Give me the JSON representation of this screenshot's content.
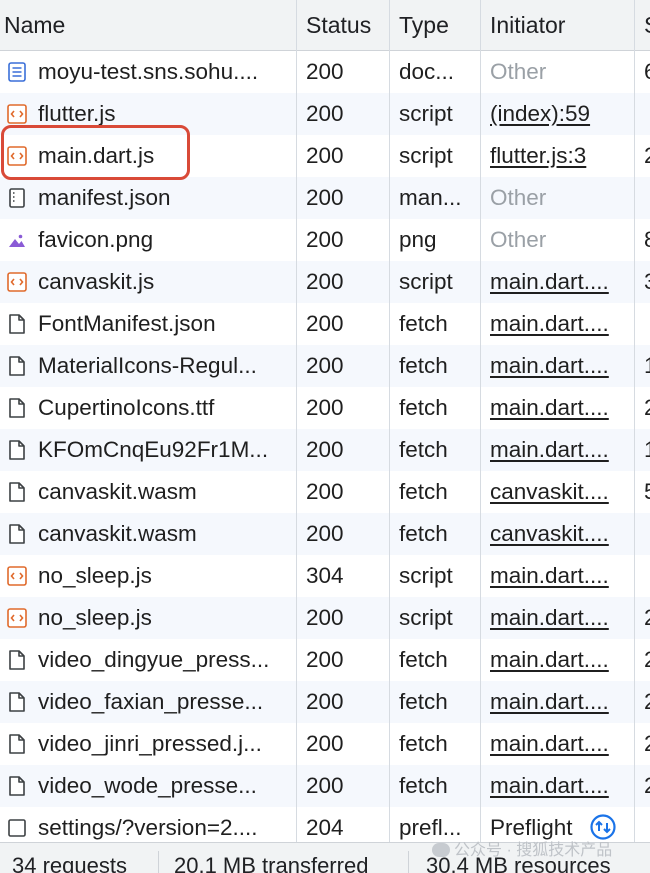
{
  "columns": {
    "name": "Name",
    "status": "Status",
    "type": "Type",
    "initiator": "Initiator",
    "size": "S"
  },
  "rows": [
    {
      "icon": "document-icon",
      "name": "moyu-test.sns.sohu....",
      "status": "200",
      "type": "doc...",
      "initiator": "Other",
      "initiator_link": false,
      "size": "6"
    },
    {
      "icon": "script-icon",
      "name": "flutter.js",
      "status": "200",
      "type": "script",
      "initiator": "(index):59",
      "initiator_link": true,
      "size": ""
    },
    {
      "icon": "script-icon",
      "name": "main.dart.js",
      "status": "200",
      "type": "script",
      "initiator": "flutter.js:3",
      "initiator_link": true,
      "size": "2"
    },
    {
      "icon": "manifest-icon",
      "name": "manifest.json",
      "status": "200",
      "type": "man...",
      "initiator": "Other",
      "initiator_link": false,
      "size": ""
    },
    {
      "icon": "image-icon",
      "name": "favicon.png",
      "status": "200",
      "type": "png",
      "initiator": "Other",
      "initiator_link": false,
      "size": "8"
    },
    {
      "icon": "script-icon",
      "name": "canvaskit.js",
      "status": "200",
      "type": "script",
      "initiator": "main.dart....",
      "initiator_link": true,
      "size": "3"
    },
    {
      "icon": "file-icon",
      "name": "FontManifest.json",
      "status": "200",
      "type": "fetch",
      "initiator": "main.dart....",
      "initiator_link": true,
      "size": ""
    },
    {
      "icon": "file-icon",
      "name": "MaterialIcons-Regul...",
      "status": "200",
      "type": "fetch",
      "initiator": "main.dart....",
      "initiator_link": true,
      "size": "1"
    },
    {
      "icon": "file-icon",
      "name": "CupertinoIcons.ttf",
      "status": "200",
      "type": "fetch",
      "initiator": "main.dart....",
      "initiator_link": true,
      "size": "2"
    },
    {
      "icon": "file-icon",
      "name": "KFOmCnqEu92Fr1M...",
      "status": "200",
      "type": "fetch",
      "initiator": "main.dart....",
      "initiator_link": true,
      "size": "1"
    },
    {
      "icon": "file-icon",
      "name": "canvaskit.wasm",
      "status": "200",
      "type": "fetch",
      "initiator": "canvaskit....",
      "initiator_link": true,
      "size": "5"
    },
    {
      "icon": "file-icon",
      "name": "canvaskit.wasm",
      "status": "200",
      "type": "fetch",
      "initiator": "canvaskit....",
      "initiator_link": true,
      "size": ""
    },
    {
      "icon": "script-icon",
      "name": "no_sleep.js",
      "status": "304",
      "type": "script",
      "initiator": "main.dart....",
      "initiator_link": true,
      "size": ""
    },
    {
      "icon": "script-icon",
      "name": "no_sleep.js",
      "status": "200",
      "type": "script",
      "initiator": "main.dart....",
      "initiator_link": true,
      "size": "2"
    },
    {
      "icon": "file-icon",
      "name": "video_dingyue_press...",
      "status": "200",
      "type": "fetch",
      "initiator": "main.dart....",
      "initiator_link": true,
      "size": "2"
    },
    {
      "icon": "file-icon",
      "name": "video_faxian_presse...",
      "status": "200",
      "type": "fetch",
      "initiator": "main.dart....",
      "initiator_link": true,
      "size": "2"
    },
    {
      "icon": "file-icon",
      "name": "video_jinri_pressed.j...",
      "status": "200",
      "type": "fetch",
      "initiator": "main.dart....",
      "initiator_link": true,
      "size": "2"
    },
    {
      "icon": "file-icon",
      "name": "video_wode_presse...",
      "status": "200",
      "type": "fetch",
      "initiator": "main.dart....",
      "initiator_link": true,
      "size": "2"
    },
    {
      "icon": "checkbox-icon",
      "name": "settings/?version=2....",
      "status": "204",
      "type": "prefl...",
      "initiator": "Preflight",
      "initiator_link": false,
      "size": ""
    }
  ],
  "footer": {
    "requests": "34 requests",
    "transferred": "20.1 MB transferred",
    "resources": "30.4 MB resources"
  },
  "watermark": {
    "text": "公众号 · 搜狐技术产品",
    "icon": "wechat-icon"
  },
  "colors": {
    "script_icon": "#e06a2c",
    "document_icon": "#3a6fd8",
    "highlight": "#d94a38",
    "preflight_icon": "#1a73e8"
  }
}
